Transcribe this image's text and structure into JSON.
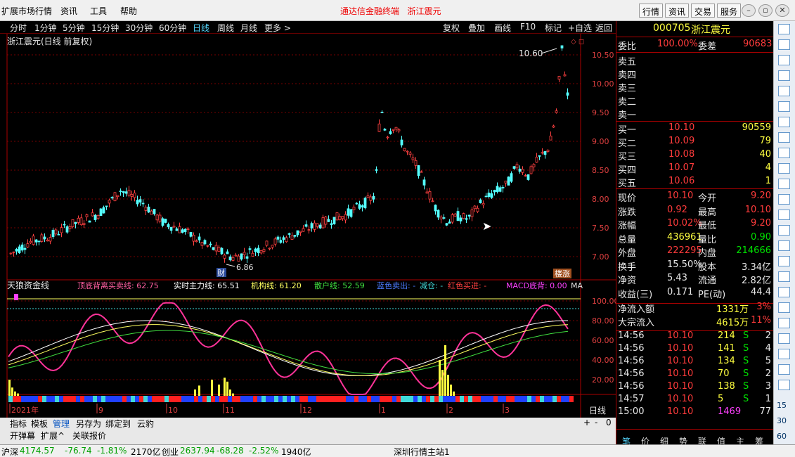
{
  "menu": {
    "items": [
      "扩展市场行情",
      "资讯",
      "工具",
      "帮助"
    ],
    "title_left": "通达信金融终端",
    "title_right": "浙江震元",
    "right_buttons": [
      "行情",
      "资讯",
      "交易",
      "服务"
    ],
    "window_controls": [
      "minimize-icon",
      "restore-icon",
      "close-icon"
    ]
  },
  "toolbar": {
    "periods": [
      "分时",
      "1分钟",
      "5分钟",
      "15分钟",
      "30分钟",
      "60分钟",
      "日线",
      "周线",
      "月线",
      "更多 >"
    ],
    "selected": "日线",
    "actions": [
      "复权",
      "叠加",
      "画线",
      "F10",
      "标记",
      "+自选",
      "返回"
    ]
  },
  "chart": {
    "stock_title": "浙江震元(日线 前复权)",
    "high_label": "10.60",
    "low_label": "6.86",
    "marker_cai": "财",
    "marker_limit": "楼涨",
    "price_axis": [
      "10.50",
      "10.00",
      "9.50",
      "9.00",
      "8.50",
      "8.00",
      "7.50",
      "7.00"
    ],
    "indicator_name": "天狼资金线",
    "indicator_items": [
      {
        "label": "顶底背离买卖线: 62.75",
        "color": "#ff5fa0"
      },
      {
        "label": "实时主力线: 65.51",
        "color": "#ffffff"
      },
      {
        "label": "机构线: 61.20",
        "color": "#ffff60"
      },
      {
        "label": "散户线: 52.59",
        "color": "#40e040"
      },
      {
        "label": "蓝色卖出: -",
        "color": "#4c7cff"
      },
      {
        "label": "减仓: -",
        "color": "#40d8d8"
      },
      {
        "label": "红色买进: -",
        "color": "#ff4040"
      },
      {
        "label": "MACD底背: 0.00",
        "color": "#ff40ff"
      },
      {
        "label": "MA",
        "color": "#e0e0e0"
      }
    ],
    "ind_axis": [
      "100.00",
      "80.00",
      "60.00",
      "40.00",
      "20.00"
    ],
    "date_labels": [
      "2021年",
      "9",
      "10",
      "11",
      "12",
      "1",
      "2",
      "3"
    ],
    "period_label": "日线"
  },
  "bottom_tabs": [
    "指标",
    "模板",
    "管理",
    "另存为",
    "绑定到",
    "云豹"
  ],
  "bottom_tabs2": [
    "开弹幕",
    "扩展^",
    "关联报价"
  ],
  "quote": {
    "code": "000705",
    "name": "浙江震元",
    "weibi_label": "委比",
    "weibi": "100.00%",
    "weicha_label": "委差",
    "weicha": "90683",
    "sells": [
      "卖五",
      "卖四",
      "卖三",
      "卖二",
      "卖一"
    ],
    "buys": [
      {
        "label": "买一",
        "price": "10.10",
        "vol": "90559"
      },
      {
        "label": "买二",
        "price": "10.09",
        "vol": "79"
      },
      {
        "label": "买三",
        "price": "10.08",
        "vol": "40"
      },
      {
        "label": "买四",
        "price": "10.07",
        "vol": "4"
      },
      {
        "label": "买五",
        "price": "10.06",
        "vol": "1"
      }
    ],
    "stats": [
      {
        "l1": "现价",
        "v1": "10.10",
        "c1": "red",
        "l2": "今开",
        "v2": "9.20",
        "c2": "red"
      },
      {
        "l1": "涨跌",
        "v1": "0.92",
        "c1": "red",
        "l2": "最高",
        "v2": "10.10",
        "c2": "red"
      },
      {
        "l1": "涨幅",
        "v1": "10.02%",
        "c1": "red",
        "l2": "最低",
        "v2": "9.20",
        "c2": "red"
      },
      {
        "l1": "总量",
        "v1": "436961",
        "c1": "yel",
        "l2": "量比",
        "v2": "0.90",
        "c2": "grn"
      },
      {
        "l1": "外盘",
        "v1": "222295",
        "c1": "red",
        "l2": "内盘",
        "v2": "214666",
        "c2": "grn"
      },
      {
        "l1": "换手",
        "v1": "15.50%",
        "c1": "wht",
        "l2": "股本",
        "v2": "3.34亿",
        "c2": "wht"
      },
      {
        "l1": "净资",
        "v1": "5.43",
        "c1": "wht",
        "l2": "流通",
        "v2": "2.82亿",
        "c2": "wht"
      },
      {
        "l1": "收益(三)",
        "v1": "0.171",
        "c1": "wht",
        "l2": "PE(动)",
        "v2": "44.4",
        "c2": "wht"
      }
    ],
    "flow": [
      {
        "label": "净流入额",
        "value": "1331万",
        "pct": "3%"
      },
      {
        "label": "大宗流入",
        "value": "4615万",
        "pct": "11%"
      }
    ],
    "ticks": [
      {
        "time": "14:56",
        "price": "10.10",
        "vol": "214",
        "side": "S",
        "n": "2"
      },
      {
        "time": "14:56",
        "price": "10.10",
        "vol": "141",
        "side": "S",
        "n": "4"
      },
      {
        "time": "14:56",
        "price": "10.10",
        "vol": "134",
        "side": "S",
        "n": "5"
      },
      {
        "time": "14:56",
        "price": "10.10",
        "vol": "70",
        "side": "S",
        "n": "2"
      },
      {
        "time": "14:56",
        "price": "10.10",
        "vol": "138",
        "side": "S",
        "n": "3"
      },
      {
        "time": "14:57",
        "price": "10.10",
        "vol": "5",
        "side": "S",
        "n": "1"
      },
      {
        "time": "15:00",
        "price": "10.10",
        "vol": "1469",
        "side": "",
        "n": "77"
      }
    ],
    "bottom_tabs": [
      "笔",
      "价",
      "细",
      "势",
      "联",
      "值",
      "主",
      "筹"
    ]
  },
  "status": {
    "index1_name": "沪深",
    "index1_val": "4174.57",
    "index1_chg": "-76.74",
    "index1_pct": "-1.81%",
    "index1_amt": "2170亿",
    "index2_name": "创业",
    "index2_val": "2637.94",
    "index2_chg": "-68.28",
    "index2_pct": "-2.52%",
    "index2_amt": "1940亿",
    "server": "深圳行情主站1"
  },
  "right_toolbar_numbers": [
    "15",
    "30",
    "60"
  ]
}
